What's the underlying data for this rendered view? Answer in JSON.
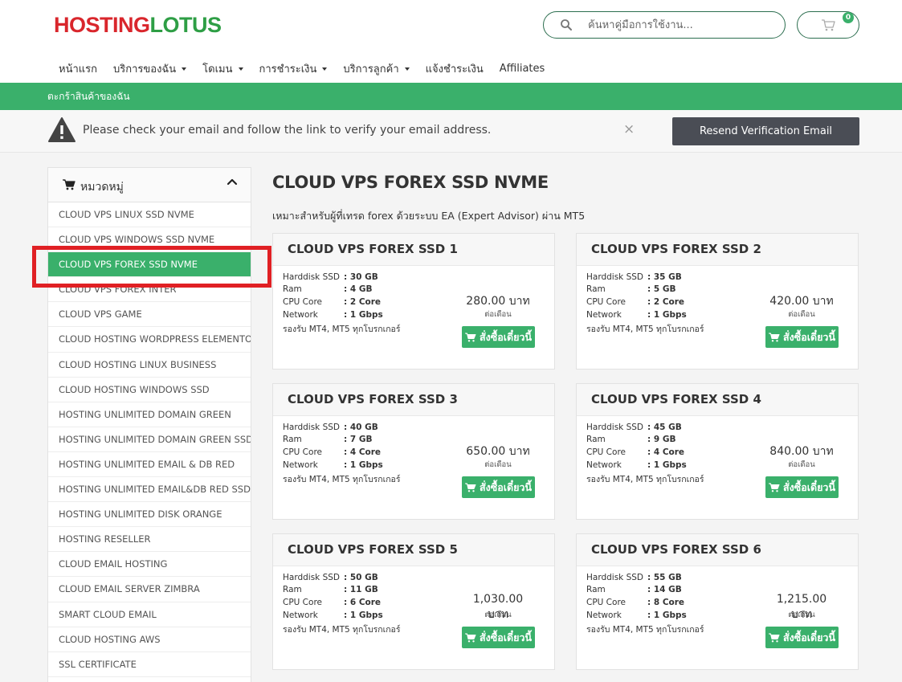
{
  "logo": {
    "part1": "HOSTING",
    "part2": "LOTUS"
  },
  "search": {
    "placeholder": "ค้นหาคู่มือการใช้งาน..."
  },
  "cart": {
    "count": "0"
  },
  "nav": [
    {
      "label": "หน้าแรก",
      "dropdown": false
    },
    {
      "label": "บริการของฉัน",
      "dropdown": true
    },
    {
      "label": "โดเมน",
      "dropdown": true
    },
    {
      "label": "การชำระเงิน",
      "dropdown": true
    },
    {
      "label": "บริการลูกค้า",
      "dropdown": true
    },
    {
      "label": "แจ้งชำระเงิน",
      "dropdown": false
    },
    {
      "label": "Affiliates",
      "dropdown": false
    }
  ],
  "breadcrumb": {
    "label": "ตะกร้าสินค้าของฉัน"
  },
  "alert": {
    "message": "Please check your email and follow the link to verify your email address.",
    "close": "×",
    "button": "Resend Verification Email"
  },
  "sidebar": {
    "title": "หมวดหมู่",
    "items": [
      "CLOUD VPS LINUX SSD NVME",
      "CLOUD VPS WINDOWS SSD NVME",
      "CLOUD VPS FOREX SSD NVME",
      "CLOUD VPS FOREX INTER",
      "CLOUD VPS GAME",
      "CLOUD HOSTING WORDPRESS ELEMENTOR",
      "CLOUD HOSTING LINUX BUSINESS",
      "CLOUD HOSTING WINDOWS SSD",
      "HOSTING UNLIMITED DOMAIN GREEN",
      "HOSTING UNLIMITED DOMAIN GREEN SSD",
      "HOSTING UNLIMITED EMAIL & DB RED",
      "HOSTING UNLIMITED EMAIL&DB RED SSD",
      "HOSTING UNLIMITED DISK ORANGE",
      "HOSTING RESELLER",
      "CLOUD EMAIL HOSTING",
      "CLOUD EMAIL SERVER ZIMBRA",
      "SMART CLOUD EMAIL",
      "CLOUD HOSTING AWS",
      "SSL CERTIFICATE"
    ],
    "active_index": 2
  },
  "main": {
    "title": "CLOUD VPS FOREX SSD NVME",
    "description": "เหมาะสำหรับผู้ที่เทรด forex ด้วยระบบ EA (Expert Advisor) ผ่าน MT5"
  },
  "spec_labels": {
    "disk": "Harddisk SSD",
    "ram": "Ram",
    "cpu": "CPU Core",
    "network": "Network",
    "colon": ":"
  },
  "products": [
    {
      "name": "CLOUD VPS FOREX SSD 1",
      "disk": "30 GB",
      "ram": "4 GB",
      "cpu": "2 Core",
      "network": "1 Gbps",
      "support": "รองรับ MT4, MT5 ทุกโบรกเกอร์",
      "price": "280.00 บาท",
      "period": "ต่อเดือน",
      "button": "สั่งซื้อเดี๋ยวนี้"
    },
    {
      "name": "CLOUD VPS FOREX SSD 2",
      "disk": "35 GB",
      "ram": "5 GB",
      "cpu": "2 Core",
      "network": "1 Gbps",
      "support": "รองรับ MT4, MT5 ทุกโบรกเกอร์",
      "price": "420.00 บาท",
      "period": "ต่อเดือน",
      "button": "สั่งซื้อเดี๋ยวนี้"
    },
    {
      "name": "CLOUD VPS FOREX SSD 3",
      "disk": "40 GB",
      "ram": "7 GB",
      "cpu": "4 Core",
      "network": "1 Gbps",
      "support": "รองรับ MT4, MT5 ทุกโบรกเกอร์",
      "price": "650.00 บาท",
      "period": "ต่อเดือน",
      "button": "สั่งซื้อเดี๋ยวนี้"
    },
    {
      "name": "CLOUD VPS FOREX SSD 4",
      "disk": "45 GB",
      "ram": "9 GB",
      "cpu": "4 Core",
      "network": "1 Gbps",
      "support": "รองรับ MT4, MT5 ทุกโบรกเกอร์",
      "price": "840.00 บาท",
      "period": "ต่อเดือน",
      "button": "สั่งซื้อเดี๋ยวนี้"
    },
    {
      "name": "CLOUD VPS FOREX SSD 5",
      "disk": "50 GB",
      "ram": "11 GB",
      "cpu": "6 Core",
      "network": "1 Gbps",
      "support": "รองรับ MT4, MT5 ทุกโบรกเกอร์",
      "price": "1,030.00 บาท",
      "period": "ต่อเดือน",
      "button": "สั่งซื้อเดี๋ยวนี้"
    },
    {
      "name": "CLOUD VPS FOREX SSD 6",
      "disk": "55 GB",
      "ram": "14 GB",
      "cpu": "8 Core",
      "network": "1 Gbps",
      "support": "รองรับ MT4, MT5 ทุกโบรกเกอร์",
      "price": "1,215.00 บาท",
      "period": "ต่อเดือน",
      "button": "สั่งซื้อเดี๋ยวนี้"
    }
  ],
  "colors": {
    "brand_green": "#3ab06b",
    "logo_red": "#d9262c",
    "logo_green": "#2e9e45",
    "dark_button": "#4a4d55",
    "highlight_red": "#e02024"
  }
}
